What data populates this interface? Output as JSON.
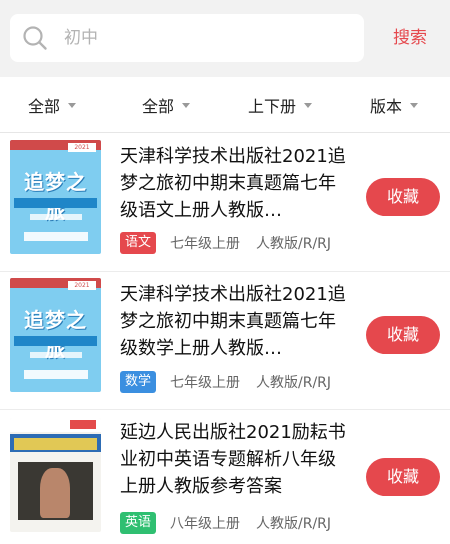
{
  "search": {
    "placeholder": "初中",
    "button_label": "搜索"
  },
  "filters": [
    {
      "label": "全部"
    },
    {
      "label": "全部"
    },
    {
      "label": "上下册"
    },
    {
      "label": "版本"
    }
  ],
  "books": [
    {
      "title": "天津科学技术出版社2021追梦之旅初中期末真题篇七年级语文上册人教版…",
      "subject": "语文",
      "subject_color": "#e5484d",
      "grade": "七年级上册",
      "edition": "人教版/R/RJ",
      "fav_label": "收藏",
      "cover": {
        "title": "追梦之旅",
        "badge": "2021"
      }
    },
    {
      "title": "天津科学技术出版社2021追梦之旅初中期末真题篇七年级数学上册人教版…",
      "subject": "数学",
      "subject_color": "#3b8fe0",
      "grade": "七年级上册",
      "edition": "人教版/R/RJ",
      "fav_label": "收藏",
      "cover": {
        "title": "追梦之旅",
        "badge": "2021"
      }
    },
    {
      "title": "延边人民出版社2021励耘书业初中英语专题解析八年级上册人教版参考答案",
      "subject": "英语",
      "subject_color": "#2fbf71",
      "grade": "八年级上册",
      "edition": "人教版/R/RJ",
      "fav_label": "收藏",
      "cover": {
        "title": "",
        "badge": ""
      }
    }
  ]
}
